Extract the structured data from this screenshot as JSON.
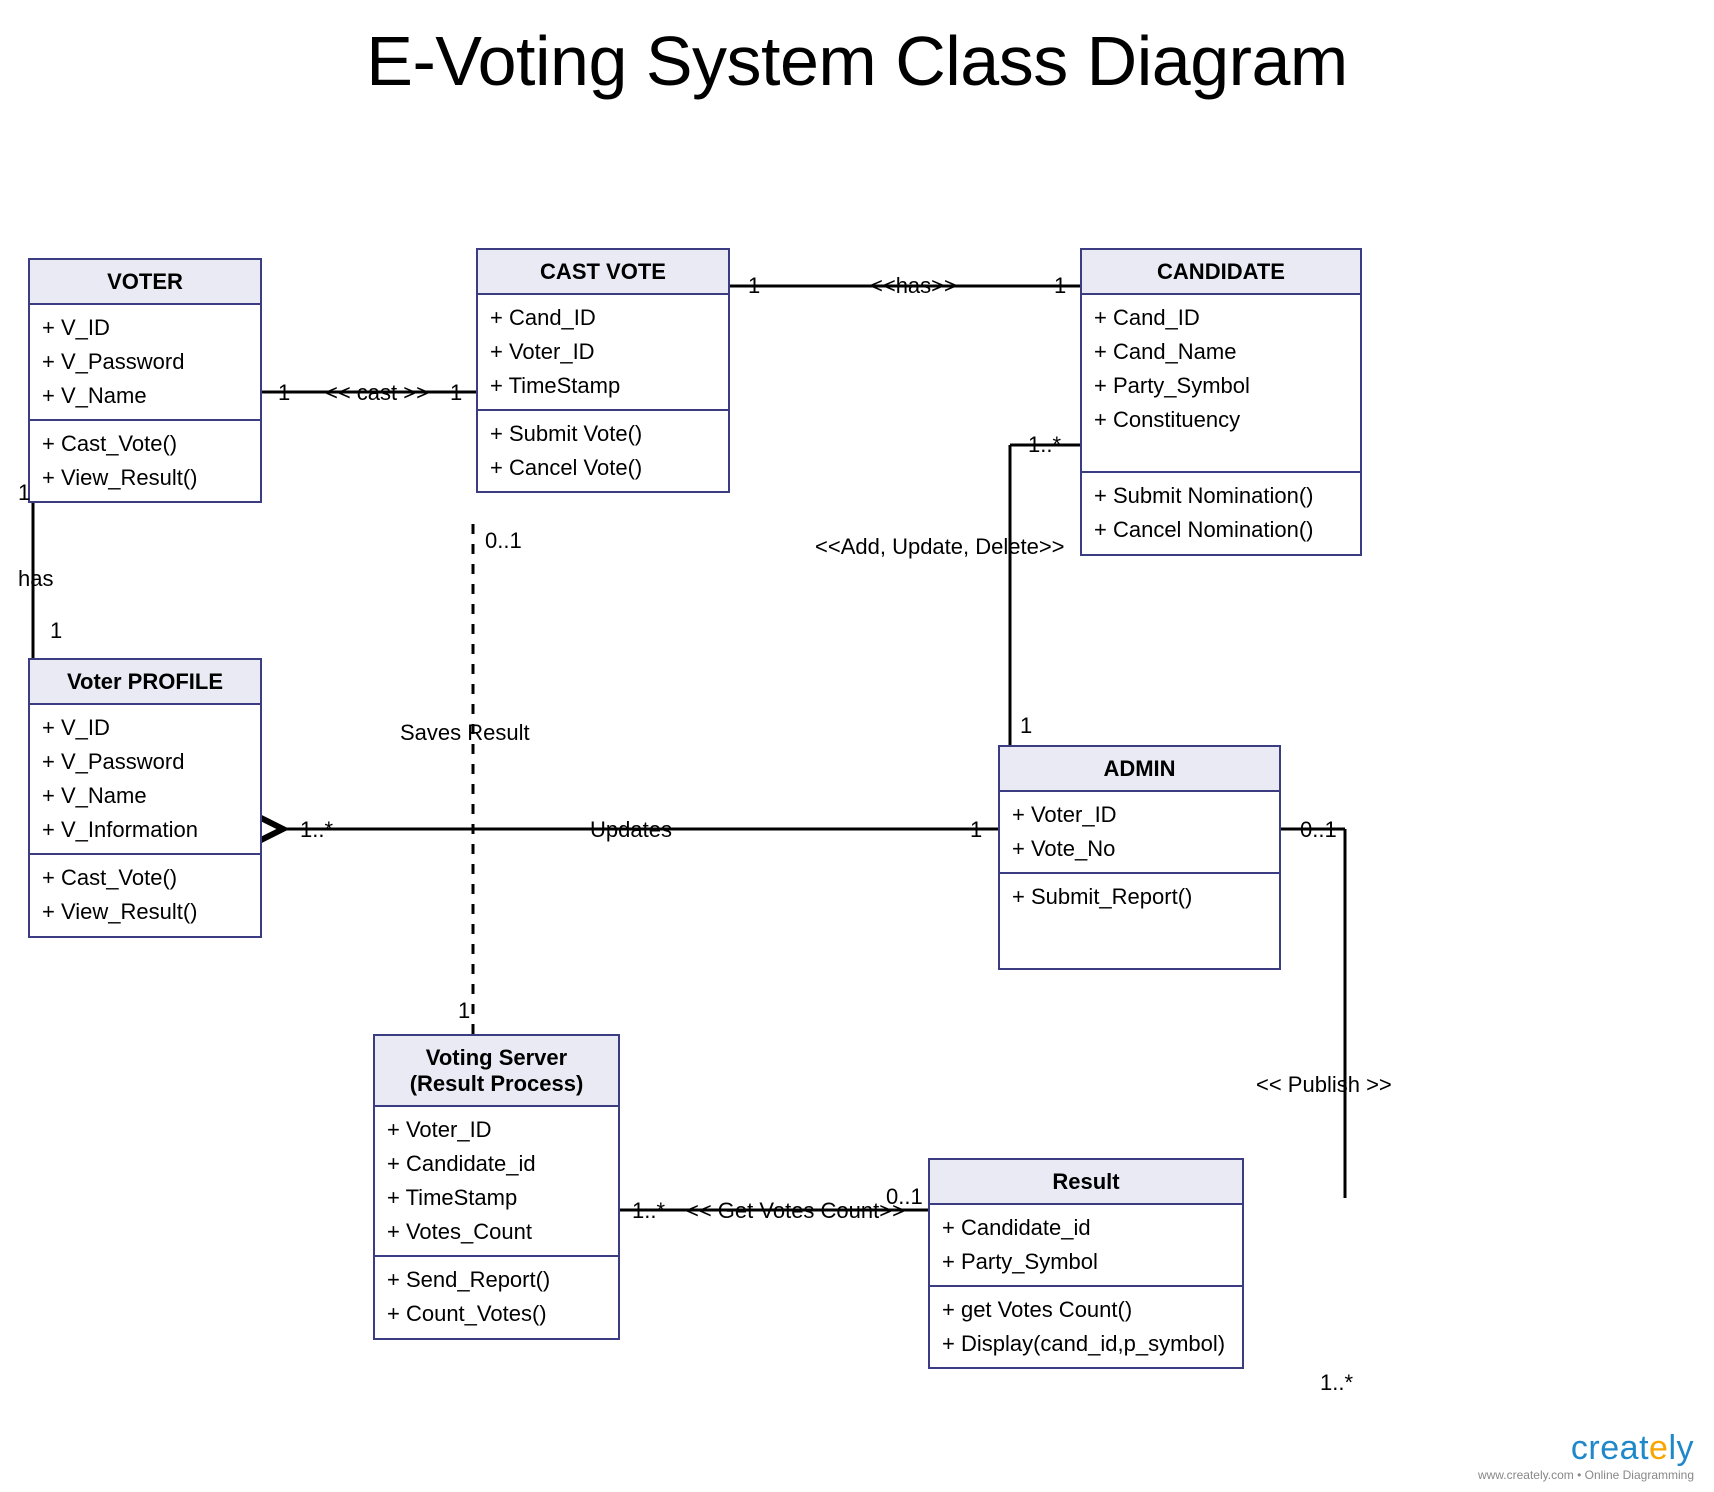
{
  "title": "E-Voting System Class Diagram",
  "classes": {
    "voter": {
      "name": "VOTER",
      "attrs": [
        "+ V_ID",
        "+ V_Password",
        "+ V_Name"
      ],
      "ops": [
        "+ Cast_Vote()",
        "+ View_Result()"
      ]
    },
    "castvote": {
      "name": "CAST VOTE",
      "attrs": [
        "+ Cand_ID",
        "+ Voter_ID",
        "+ TimeStamp"
      ],
      "ops": [
        "+ Submit Vote()",
        "+ Cancel Vote()"
      ]
    },
    "candidate": {
      "name": "CANDIDATE",
      "attrs": [
        "+ Cand_ID",
        "+ Cand_Name",
        "+ Party_Symbol",
        "+ Constituency"
      ],
      "ops": [
        "+ Submit Nomination()",
        "+ Cancel Nomination()"
      ]
    },
    "voterprofile": {
      "name": "Voter PROFILE",
      "attrs": [
        "+ V_ID",
        "+ V_Password",
        "+ V_Name",
        "+ V_Information"
      ],
      "ops": [
        "+ Cast_Vote()",
        "+ View_Result()"
      ]
    },
    "admin": {
      "name": "ADMIN",
      "attrs": [
        "+ Voter_ID",
        "+ Vote_No"
      ],
      "ops": [
        "+ Submit_Report()"
      ]
    },
    "votingserver": {
      "name_l1": "Voting Server",
      "name_l2": "(Result Process)",
      "attrs": [
        "+ Voter_ID",
        "+ Candidate_id",
        "+ TimeStamp",
        "+ Votes_Count"
      ],
      "ops": [
        "+ Send_Report()",
        "+ Count_Votes()"
      ]
    },
    "result": {
      "name": "Result",
      "attrs": [
        "+ Candidate_id",
        "+ Party_Symbol"
      ],
      "ops": [
        "+ get Votes Count()",
        "+ Display(cand_id,p_symbol)"
      ]
    }
  },
  "labels": {
    "cast": "<< cast >>",
    "has_top": "<<has>>",
    "has_left": "has",
    "saves": "Saves Result",
    "updates": "Updates",
    "adddel": "<<Add, Update, Delete>>",
    "getvotes": "<< Get Votes Count>>",
    "publish": "<< Publish >>"
  },
  "mult": {
    "voter_castvote_a": "1",
    "voter_castvote_b": "1",
    "castvote_cand_a": "1",
    "castvote_cand_b": "1",
    "voter_profile_a": "1",
    "voter_profile_b": "1",
    "castvote_server_a": "0..1",
    "castvote_server_b": "1",
    "server_profile_a": "1..*",
    "admin_server": "1",
    "admin_cand_a": "1",
    "admin_cand_b": "1..*",
    "admin_result_a": "0..1",
    "admin_result_b": "1..*",
    "server_result_a": "1..*",
    "server_result_b": "0..1"
  },
  "brand": {
    "name": "creately",
    "sub": "www.creately.com • Online Diagramming"
  }
}
